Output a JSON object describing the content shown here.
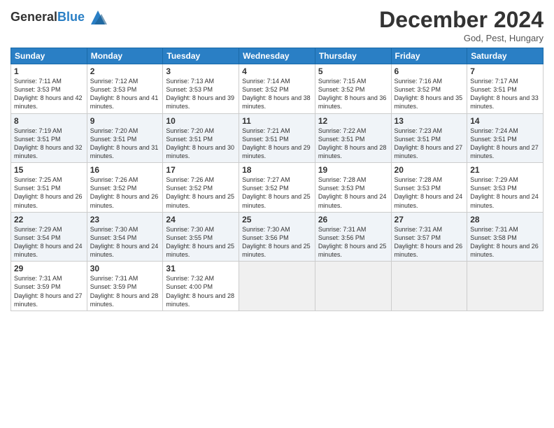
{
  "logo": {
    "general": "General",
    "blue": "Blue"
  },
  "title": "December 2024",
  "location": "God, Pest, Hungary",
  "weekdays": [
    "Sunday",
    "Monday",
    "Tuesday",
    "Wednesday",
    "Thursday",
    "Friday",
    "Saturday"
  ],
  "weeks": [
    [
      {
        "day": "1",
        "sunrise": "7:11 AM",
        "sunset": "3:53 PM",
        "daylight": "8 hours and 42 minutes."
      },
      {
        "day": "2",
        "sunrise": "7:12 AM",
        "sunset": "3:53 PM",
        "daylight": "8 hours and 41 minutes."
      },
      {
        "day": "3",
        "sunrise": "7:13 AM",
        "sunset": "3:53 PM",
        "daylight": "8 hours and 39 minutes."
      },
      {
        "day": "4",
        "sunrise": "7:14 AM",
        "sunset": "3:52 PM",
        "daylight": "8 hours and 38 minutes."
      },
      {
        "day": "5",
        "sunrise": "7:15 AM",
        "sunset": "3:52 PM",
        "daylight": "8 hours and 36 minutes."
      },
      {
        "day": "6",
        "sunrise": "7:16 AM",
        "sunset": "3:52 PM",
        "daylight": "8 hours and 35 minutes."
      },
      {
        "day": "7",
        "sunrise": "7:17 AM",
        "sunset": "3:51 PM",
        "daylight": "8 hours and 33 minutes."
      }
    ],
    [
      {
        "day": "8",
        "sunrise": "7:19 AM",
        "sunset": "3:51 PM",
        "daylight": "8 hours and 32 minutes."
      },
      {
        "day": "9",
        "sunrise": "7:20 AM",
        "sunset": "3:51 PM",
        "daylight": "8 hours and 31 minutes."
      },
      {
        "day": "10",
        "sunrise": "7:20 AM",
        "sunset": "3:51 PM",
        "daylight": "8 hours and 30 minutes."
      },
      {
        "day": "11",
        "sunrise": "7:21 AM",
        "sunset": "3:51 PM",
        "daylight": "8 hours and 29 minutes."
      },
      {
        "day": "12",
        "sunrise": "7:22 AM",
        "sunset": "3:51 PM",
        "daylight": "8 hours and 28 minutes."
      },
      {
        "day": "13",
        "sunrise": "7:23 AM",
        "sunset": "3:51 PM",
        "daylight": "8 hours and 27 minutes."
      },
      {
        "day": "14",
        "sunrise": "7:24 AM",
        "sunset": "3:51 PM",
        "daylight": "8 hours and 27 minutes."
      }
    ],
    [
      {
        "day": "15",
        "sunrise": "7:25 AM",
        "sunset": "3:51 PM",
        "daylight": "8 hours and 26 minutes."
      },
      {
        "day": "16",
        "sunrise": "7:26 AM",
        "sunset": "3:52 PM",
        "daylight": "8 hours and 26 minutes."
      },
      {
        "day": "17",
        "sunrise": "7:26 AM",
        "sunset": "3:52 PM",
        "daylight": "8 hours and 25 minutes."
      },
      {
        "day": "18",
        "sunrise": "7:27 AM",
        "sunset": "3:52 PM",
        "daylight": "8 hours and 25 minutes."
      },
      {
        "day": "19",
        "sunrise": "7:28 AM",
        "sunset": "3:53 PM",
        "daylight": "8 hours and 24 minutes."
      },
      {
        "day": "20",
        "sunrise": "7:28 AM",
        "sunset": "3:53 PM",
        "daylight": "8 hours and 24 minutes."
      },
      {
        "day": "21",
        "sunrise": "7:29 AM",
        "sunset": "3:53 PM",
        "daylight": "8 hours and 24 minutes."
      }
    ],
    [
      {
        "day": "22",
        "sunrise": "7:29 AM",
        "sunset": "3:54 PM",
        "daylight": "8 hours and 24 minutes."
      },
      {
        "day": "23",
        "sunrise": "7:30 AM",
        "sunset": "3:54 PM",
        "daylight": "8 hours and 24 minutes."
      },
      {
        "day": "24",
        "sunrise": "7:30 AM",
        "sunset": "3:55 PM",
        "daylight": "8 hours and 25 minutes."
      },
      {
        "day": "25",
        "sunrise": "7:30 AM",
        "sunset": "3:56 PM",
        "daylight": "8 hours and 25 minutes."
      },
      {
        "day": "26",
        "sunrise": "7:31 AM",
        "sunset": "3:56 PM",
        "daylight": "8 hours and 25 minutes."
      },
      {
        "day": "27",
        "sunrise": "7:31 AM",
        "sunset": "3:57 PM",
        "daylight": "8 hours and 26 minutes."
      },
      {
        "day": "28",
        "sunrise": "7:31 AM",
        "sunset": "3:58 PM",
        "daylight": "8 hours and 26 minutes."
      }
    ],
    [
      {
        "day": "29",
        "sunrise": "7:31 AM",
        "sunset": "3:59 PM",
        "daylight": "8 hours and 27 minutes."
      },
      {
        "day": "30",
        "sunrise": "7:31 AM",
        "sunset": "3:59 PM",
        "daylight": "8 hours and 28 minutes."
      },
      {
        "day": "31",
        "sunrise": "7:32 AM",
        "sunset": "4:00 PM",
        "daylight": "8 hours and 28 minutes."
      },
      null,
      null,
      null,
      null
    ]
  ]
}
